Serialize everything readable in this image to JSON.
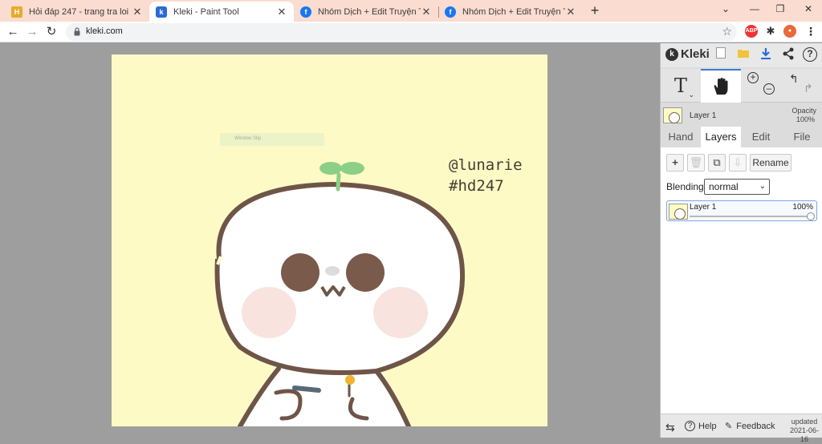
{
  "browser": {
    "tabs": [
      {
        "title": "Hỏi đáp 247 - trang tra loi",
        "favicon": "hoidap-icon",
        "active": false
      },
      {
        "title": "Kleki - Paint Tool",
        "favicon": "kleki-icon",
        "active": true
      },
      {
        "title": "Nhóm Dịch + Edit Truyện Tranh |",
        "favicon": "facebook-icon",
        "active": false
      },
      {
        "title": "Nhóm Dịch + Edit Truyện Tranh |",
        "favicon": "facebook-icon",
        "active": false
      }
    ],
    "url": "kleki.com",
    "extension_abp": "ABP"
  },
  "canvas": {
    "watermark_text": "Window Slip",
    "text_line1": "@lunarie",
    "text_line2": "#hd247",
    "background_color": "#fdfac6"
  },
  "panel": {
    "app_name": "Kleki",
    "text_tool_label": "T",
    "layer_preview_name": "Layer 1",
    "opacity_label": "Opacity",
    "opacity_value": "100%",
    "tabs": [
      "Hand",
      "Layers",
      "Edit",
      "File"
    ],
    "active_tab": "Layers",
    "rename_label": "Rename",
    "blending_label": "Blending",
    "blending_value": "normal",
    "layers": [
      {
        "name": "Layer 1",
        "opacity": "100%"
      }
    ],
    "footer": {
      "help_label": "Help",
      "feedback_label": "Feedback",
      "updated_label": "updated",
      "updated_date": "2021-06-16"
    },
    "accent_color": "#3e7bd6"
  }
}
